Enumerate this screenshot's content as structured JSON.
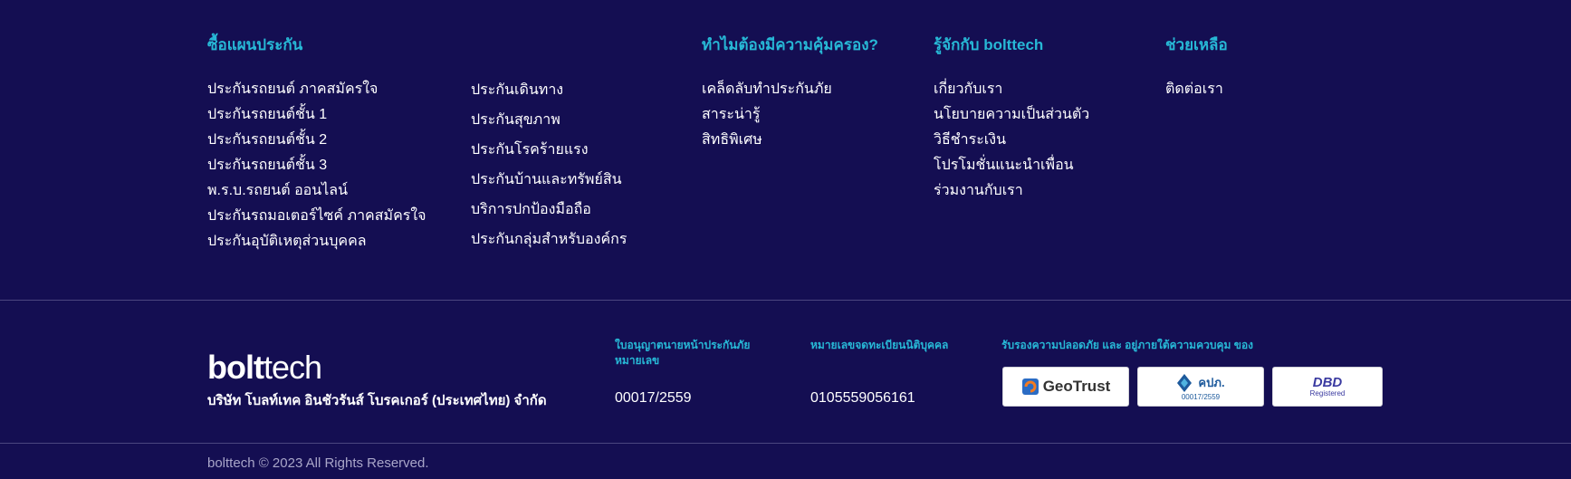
{
  "footer": {
    "col1": {
      "heading": "ซื้อแผนประกัน",
      "items": [
        "ประกันรถยนต์ ภาคสมัครใจ",
        "ประกันรถยนต์ชั้น 1",
        "ประกันรถยนต์ชั้น 2",
        "ประกันรถยนต์ชั้น 3",
        "พ.ร.บ.รถยนต์ ออนไลน์",
        "ประกันรถมอเตอร์ไซค์ ภาคสมัครใจ",
        "ประกันอุบัติเหตุส่วนบุคคล"
      ]
    },
    "col2": {
      "items": [
        "ประกันเดินทาง",
        "ประกันสุขภาพ",
        "ประกันโรคร้ายแรง",
        "ประกันบ้านและทรัพย์สิน",
        "บริการปกป้องมือถือ",
        "ประกันกลุ่มสำหรับองค์กร"
      ]
    },
    "col3": {
      "heading": "ทำไมต้องมีความคุ้มครอง?",
      "items": [
        "เคล็ดลับทำประกันภัย",
        "สาระน่ารู้",
        "สิทธิพิเศษ"
      ]
    },
    "col4": {
      "heading": "รู้จักกับ bolttech",
      "items": [
        "เกี่ยวกับเรา",
        "นโยบายความเป็นส่วนตัว",
        "วิธีชำระเงิน",
        "โปรโมชั่นแนะนำเพื่อน",
        "ร่วมงานกับเรา"
      ]
    },
    "col5": {
      "heading": "ช่วยเหลือ",
      "items": [
        "ติดต่อเรา"
      ]
    }
  },
  "company": {
    "logo_bold": "bolt",
    "logo_light": "tech",
    "name": "บริษัท โบลท์เทค อินชัวรันส์ โบรคเกอร์ (ประเทศไทย) จำกัด",
    "license_label": "ใบอนุญาตนายหน้าประกันภัย หมายเลข",
    "license_number": "00017/2559",
    "registration_label": "หมายเลขจดทะเบียนนิติบุคคล",
    "registration_number": "0105559056161",
    "certified_label": "รับรองความปลอดภัย และ อยู่ภายใต้ความควบคุม ของ",
    "badges": {
      "geotrust": "GeoTrust",
      "oic": "คปภ.",
      "oic_number": "00017/2559",
      "dbd": "DBD",
      "dbd_sub": "Registered"
    }
  },
  "copyright": "bolttech © 2023 All Rights Reserved.",
  "colors": {
    "background": "#140e52",
    "accent": "#27b8d6",
    "text": "#ffffff",
    "muted": "#a9a6c9"
  }
}
